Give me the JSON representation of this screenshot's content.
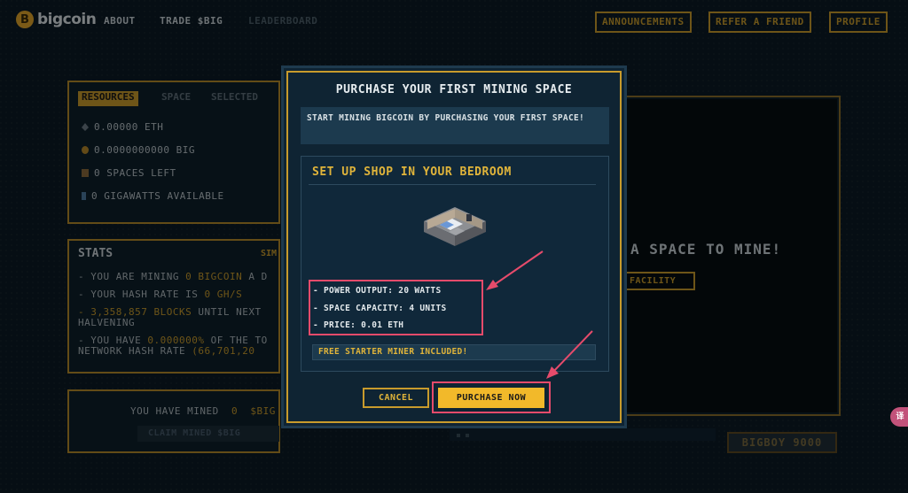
{
  "nav": {
    "logo_text": "bigcoin",
    "links": [
      "ABOUT",
      "TRADE $BIG",
      "LEADERBOARD"
    ],
    "buttons": [
      "ANNOUNCEMENTS",
      "REFER A FRIEND",
      "PROFILE"
    ]
  },
  "resources": {
    "tabs": [
      "RESOURCES",
      "SPACE",
      "SELECTED"
    ],
    "rows": [
      {
        "icon": "eth-icon",
        "text": "0.00000 ETH"
      },
      {
        "icon": "big-coin-icon",
        "text": "0.0000000000 BIG"
      },
      {
        "icon": "space-icon",
        "text": "0 SPACES LEFT"
      },
      {
        "icon": "power-icon",
        "text": "0 GIGAWATTS AVAILABLE"
      }
    ]
  },
  "stats": {
    "title": "STATS",
    "right_fragment": "SIM",
    "line1_prefix": "- YOU ARE MINING ",
    "line1_value": "0 BIGCOIN",
    "line1_suffix": " A D",
    "line2_prefix": "- YOUR HASH RATE IS ",
    "line2_value": "0 GH/S",
    "line3_value": "- 3,358,857 BLOCKS",
    "line3_suffix": " UNTIL NEXT",
    "line4": "HALVENING",
    "line5_prefix": "- YOU HAVE ",
    "line5_value": "0.000000%",
    "line5_suffix": " OF THE TO",
    "line6_prefix": "NETWORK HASH RATE ",
    "line6_value": "(66,701,20"
  },
  "mined": {
    "label": "YOU HAVE MINED",
    "value": "0",
    "unit": "$BIG",
    "claim_label": "CLAIM MINED $BIG"
  },
  "right_panel": {
    "headline_fragment": "A SPACE TO MINE!",
    "button_fragment": "FACILITY",
    "machine_label": "BIGBOY 9000"
  },
  "modal": {
    "title": "PURCHASE YOUR FIRST MINING SPACE",
    "intro": "START MINING BIGCOIN BY PURCHASING YOUR FIRST SPACE!",
    "card_title": "SET UP SHOP IN YOUR BEDROOM",
    "specs": [
      "- POWER OUTPUT: 20 WATTS",
      "- SPACE CAPACITY: 4 UNITS",
      "- PRICE: 0.01 ETH"
    ],
    "free_text": "FREE STARTER MINER INCLUDED!",
    "cancel_label": "CANCEL",
    "purchase_label": "PURCHASE NOW"
  },
  "translate_badge": "译",
  "colors": {
    "gold": "#c89b2c",
    "purchase_button": "#f2b92a",
    "annotation": "#e64b6b",
    "background": "#0b1b25"
  }
}
